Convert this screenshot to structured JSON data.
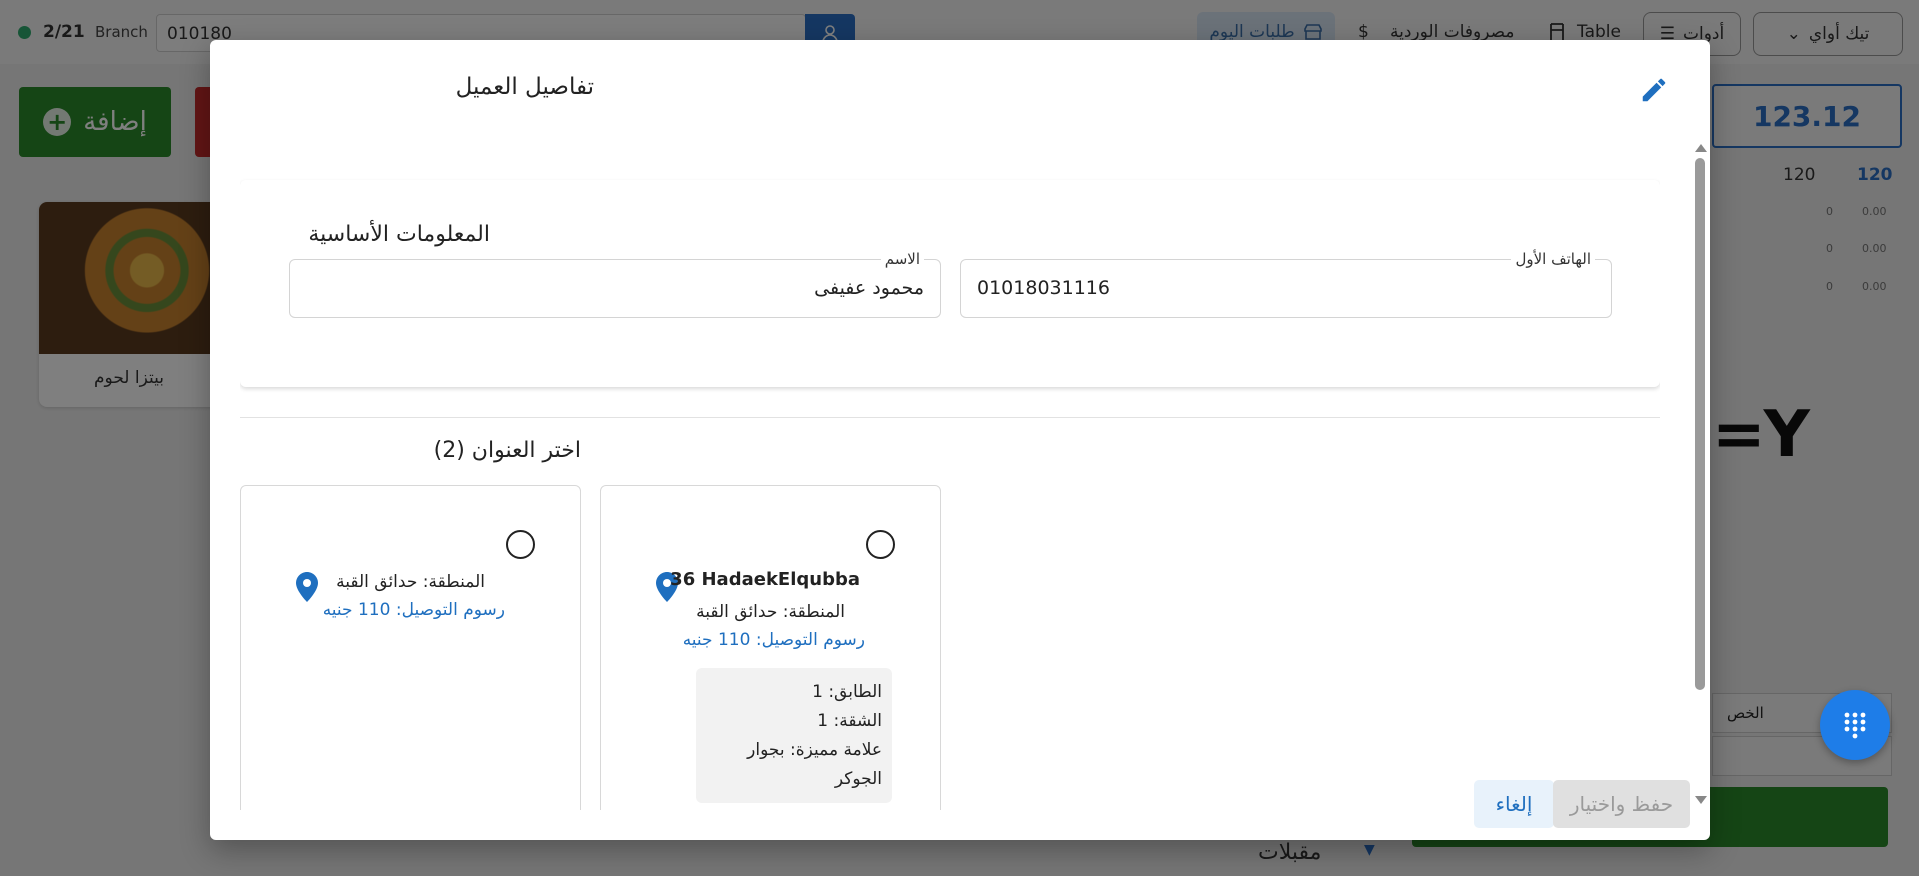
{
  "topbar": {
    "count": "2/21",
    "branch_label": "Branch",
    "search_value": "010180",
    "today_orders": "طلبات اليوم",
    "shift_expenses": "مصروفات الوردية",
    "table_label": "Table",
    "tools_label": "أدوات",
    "order_type": "تيك أواي"
  },
  "main": {
    "add_button": "إضافة",
    "product_name": "بيتزا لحوم"
  },
  "right_panel": {
    "total": "123.12",
    "val_a": "120",
    "val_b": "120",
    "rows": [
      {
        "left": "0",
        "right": "0.00"
      },
      {
        "left": "0",
        "right": "0.00"
      },
      {
        "left": "0",
        "right": "0.00"
      }
    ],
    "discount_label": "الخص",
    "bottom_label": "مقبلات"
  },
  "modal": {
    "title": "تفاصيل العميل",
    "basic_info_title": "المعلومات الأساسية",
    "name_label": "الاسم",
    "name_value": "محمود عفيفى",
    "phone_label": "الهاتف الأول",
    "phone_value": "01018031116",
    "address_heading": "اختر العنوان (2)",
    "addresses": [
      {
        "title": "36 HadaekElqubba",
        "area": "المنطقة: حدائق القبة",
        "fee": "رسوم التوصيل: 110 جنيه",
        "floor": "الطابق: 1",
        "apartment": "الشقة: 1",
        "landmark": "علامة مميزة: بجوار الجوكر"
      },
      {
        "area": "المنطقة: حدائق القبة",
        "fee": "رسوم التوصيل: 110 جنيه"
      }
    ],
    "cancel_label": "إلغاء",
    "save_label": "حفظ واختيار"
  },
  "colors": {
    "accent": "#1f6fbf",
    "primary_green": "#2a8a2a",
    "danger": "#c42b2b"
  }
}
